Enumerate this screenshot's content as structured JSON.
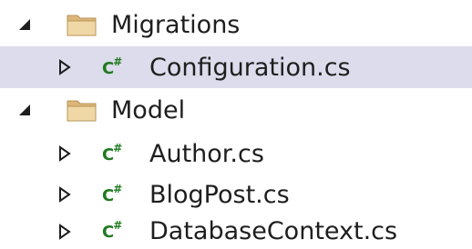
{
  "tree": {
    "items": [
      {
        "label": "Migrations",
        "type": "folder",
        "expanded": true,
        "depth": 0
      },
      {
        "label": "Configuration.cs",
        "type": "cs-file",
        "expanded": false,
        "depth": 1,
        "selected": true
      },
      {
        "label": "Model",
        "type": "folder",
        "expanded": true,
        "depth": 0
      },
      {
        "label": "Author.cs",
        "type": "cs-file",
        "expanded": false,
        "depth": 1
      },
      {
        "label": "BlogPost.cs",
        "type": "cs-file",
        "expanded": false,
        "depth": 1
      },
      {
        "label": "DatabaseContext.cs",
        "type": "cs-file",
        "expanded": false,
        "depth": 1
      }
    ],
    "cs_badge": "C#",
    "colors": {
      "selection": "#dcdcec",
      "folder_body": "#dcb67a",
      "cs_icon": "#1f7a1f"
    }
  }
}
